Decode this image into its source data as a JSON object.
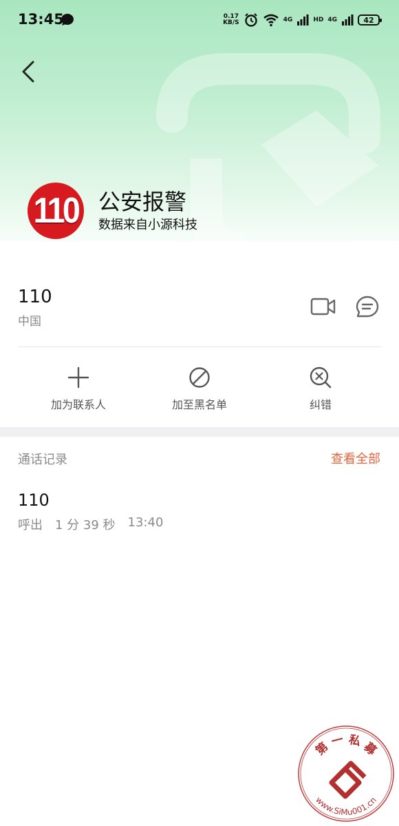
{
  "status_bar": {
    "time": "13:45",
    "net_speed_value": "0.17",
    "net_speed_unit": "KB/S",
    "signal_1_label": "4G",
    "signal_2_label": "HD",
    "signal_3_label": "4G",
    "battery": "42"
  },
  "contact": {
    "logo_text": "110",
    "name": "公安报警",
    "data_source": "数据来自小源科技",
    "number": "110",
    "region": "中国"
  },
  "actions": {
    "add_contact": "加为联系人",
    "add_blacklist": "加至黑名单",
    "correct": "纠错"
  },
  "call_log": {
    "title": "通话记录",
    "view_all": "查看全部",
    "entries": [
      {
        "number": "110",
        "direction": "呼出",
        "duration": "1 分 39 秒",
        "time": "13:40"
      }
    ]
  },
  "watermark": {
    "top_text": "第 一 私 募",
    "bottom_text": "www.SiMu001.cn"
  },
  "colors": {
    "accent": "#e8643c",
    "logo_red": "#d61a1f",
    "header_green": "#a9e6c0"
  },
  "icons": [
    "back-arrow-icon",
    "video-call-icon",
    "message-icon",
    "plus-icon",
    "block-icon",
    "correct-search-icon"
  ]
}
